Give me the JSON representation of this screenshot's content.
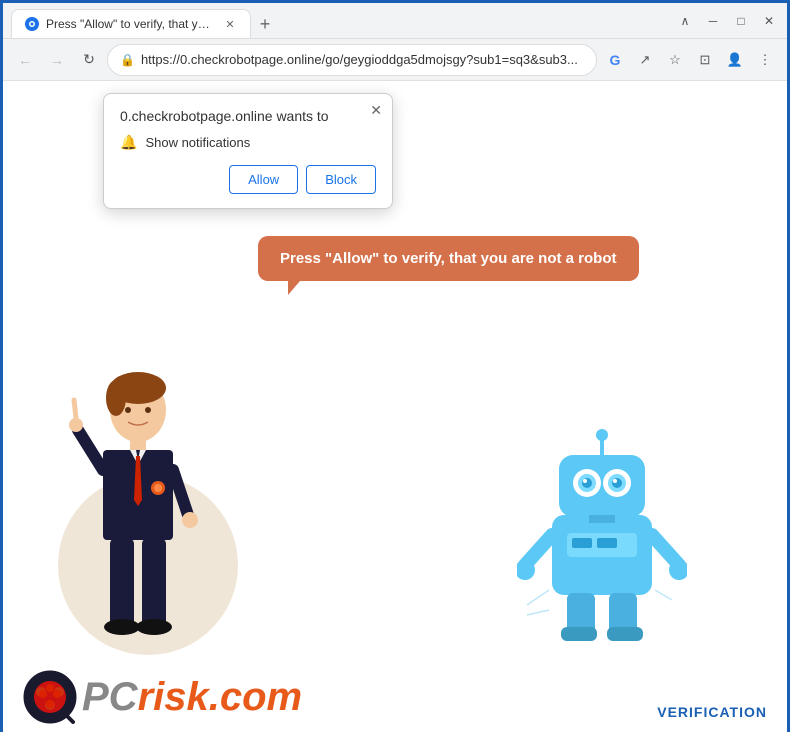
{
  "titlebar": {
    "tab_label": "Press \"Allow\" to verify, that you a...",
    "new_tab_label": "+",
    "close_label": "✕",
    "minimize_label": "─",
    "maximize_label": "□",
    "chevron_up": "∧"
  },
  "toolbar": {
    "back_arrow": "←",
    "forward_arrow": "→",
    "reload": "↻",
    "lock_icon": "🔒",
    "address": "https://0.checkrobotpage.online/go/geygioddga5dmojsgy?sub1=sq3&sub3...",
    "google_icon": "G",
    "share_icon": "↗",
    "star_icon": "☆",
    "tab_icon": "⊡",
    "profile_icon": "👤",
    "menu_icon": "⋮"
  },
  "notification_popup": {
    "title": "0.checkrobotpage.online wants to",
    "description": "Show notifications",
    "allow_label": "Allow",
    "block_label": "Block",
    "close_label": "✕"
  },
  "speech_bubble": {
    "text": "Press \"Allow\" to verify, that you are not a robot"
  },
  "branding": {
    "pcrisk_prefix": "PC",
    "pcrisk_suffix": "risk.com",
    "verification": "VERIFICATION"
  }
}
